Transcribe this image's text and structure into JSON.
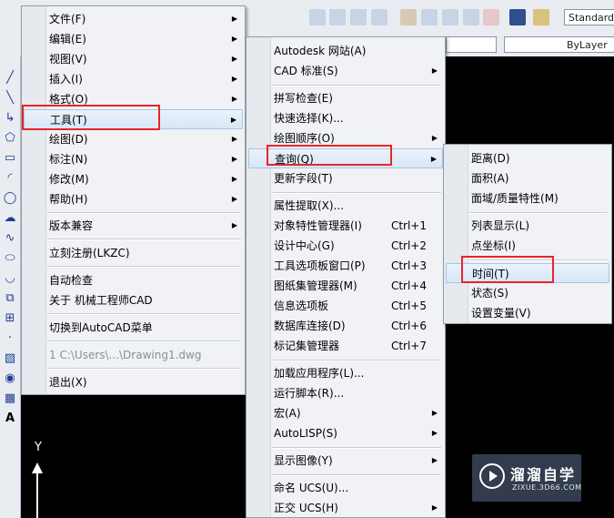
{
  "toolbar": {
    "text_style_value": "Standard",
    "layer_value": "ByLayer"
  },
  "menu_main": {
    "items": [
      {
        "label": "文件(F)"
      },
      {
        "label": "编辑(E)"
      },
      {
        "label": "视图(V)"
      },
      {
        "label": "插入(I)"
      },
      {
        "label": "格式(O)"
      },
      {
        "label": "工具(T)"
      },
      {
        "label": "绘图(D)"
      },
      {
        "label": "标注(N)"
      },
      {
        "label": "修改(M)"
      },
      {
        "label": "帮助(H)"
      },
      {
        "label": "版本兼容"
      },
      {
        "label": "立刻注册(LKZC)"
      },
      {
        "label": "自动检查"
      },
      {
        "label": "关于 机械工程师CAD"
      },
      {
        "label": "切换到AutoCAD菜单"
      },
      {
        "label": "1 C:\\Users\\...\\Drawing1.dwg"
      },
      {
        "label": "退出(X)"
      }
    ]
  },
  "menu_tools": {
    "items": [
      {
        "label": "Autodesk 网站(A)",
        "shortcut": ""
      },
      {
        "label": "CAD 标准(S)",
        "shortcut": ""
      },
      {
        "label": "拼写检查(E)",
        "shortcut": ""
      },
      {
        "label": "快速选择(K)...",
        "shortcut": ""
      },
      {
        "label": "绘图顺序(O)",
        "shortcut": ""
      },
      {
        "label": "查询(Q)",
        "shortcut": ""
      },
      {
        "label": "更新字段(T)",
        "shortcut": ""
      },
      {
        "label": "属性提取(X)...",
        "shortcut": ""
      },
      {
        "label": "对象特性管理器(I)",
        "shortcut": "Ctrl+1"
      },
      {
        "label": "设计中心(G)",
        "shortcut": "Ctrl+2"
      },
      {
        "label": "工具选项板窗口(P)",
        "shortcut": "Ctrl+3"
      },
      {
        "label": "图纸集管理器(M)",
        "shortcut": "Ctrl+4"
      },
      {
        "label": "信息选项板",
        "shortcut": "Ctrl+5"
      },
      {
        "label": "数据库连接(D)",
        "shortcut": "Ctrl+6"
      },
      {
        "label": "标记集管理器",
        "shortcut": "Ctrl+7"
      },
      {
        "label": "加载应用程序(L)...",
        "shortcut": ""
      },
      {
        "label": "运行脚本(R)...",
        "shortcut": ""
      },
      {
        "label": "宏(A)",
        "shortcut": ""
      },
      {
        "label": "AutoLISP(S)",
        "shortcut": ""
      },
      {
        "label": "显示图像(Y)",
        "shortcut": ""
      },
      {
        "label": "命名 UCS(U)...",
        "shortcut": ""
      },
      {
        "label": "正交 UCS(H)",
        "shortcut": ""
      }
    ]
  },
  "menu_query": {
    "items": [
      {
        "label": "距离(D)"
      },
      {
        "label": "面积(A)"
      },
      {
        "label": "面域/质量特性(M)"
      },
      {
        "label": "列表显示(L)"
      },
      {
        "label": "点坐标(I)"
      },
      {
        "label": "时间(T)"
      },
      {
        "label": "状态(S)"
      },
      {
        "label": "设置变量(V)"
      }
    ]
  },
  "canvas": {
    "ucs_y_label": "Y"
  },
  "watermark": {
    "title": "溜溜自学",
    "subtitle": "ZIXUE.3D66.COM"
  },
  "colors": {
    "highlight_box": "#e5262b",
    "menu_bg": "#f0f2f5",
    "canvas_bg": "#000000"
  }
}
